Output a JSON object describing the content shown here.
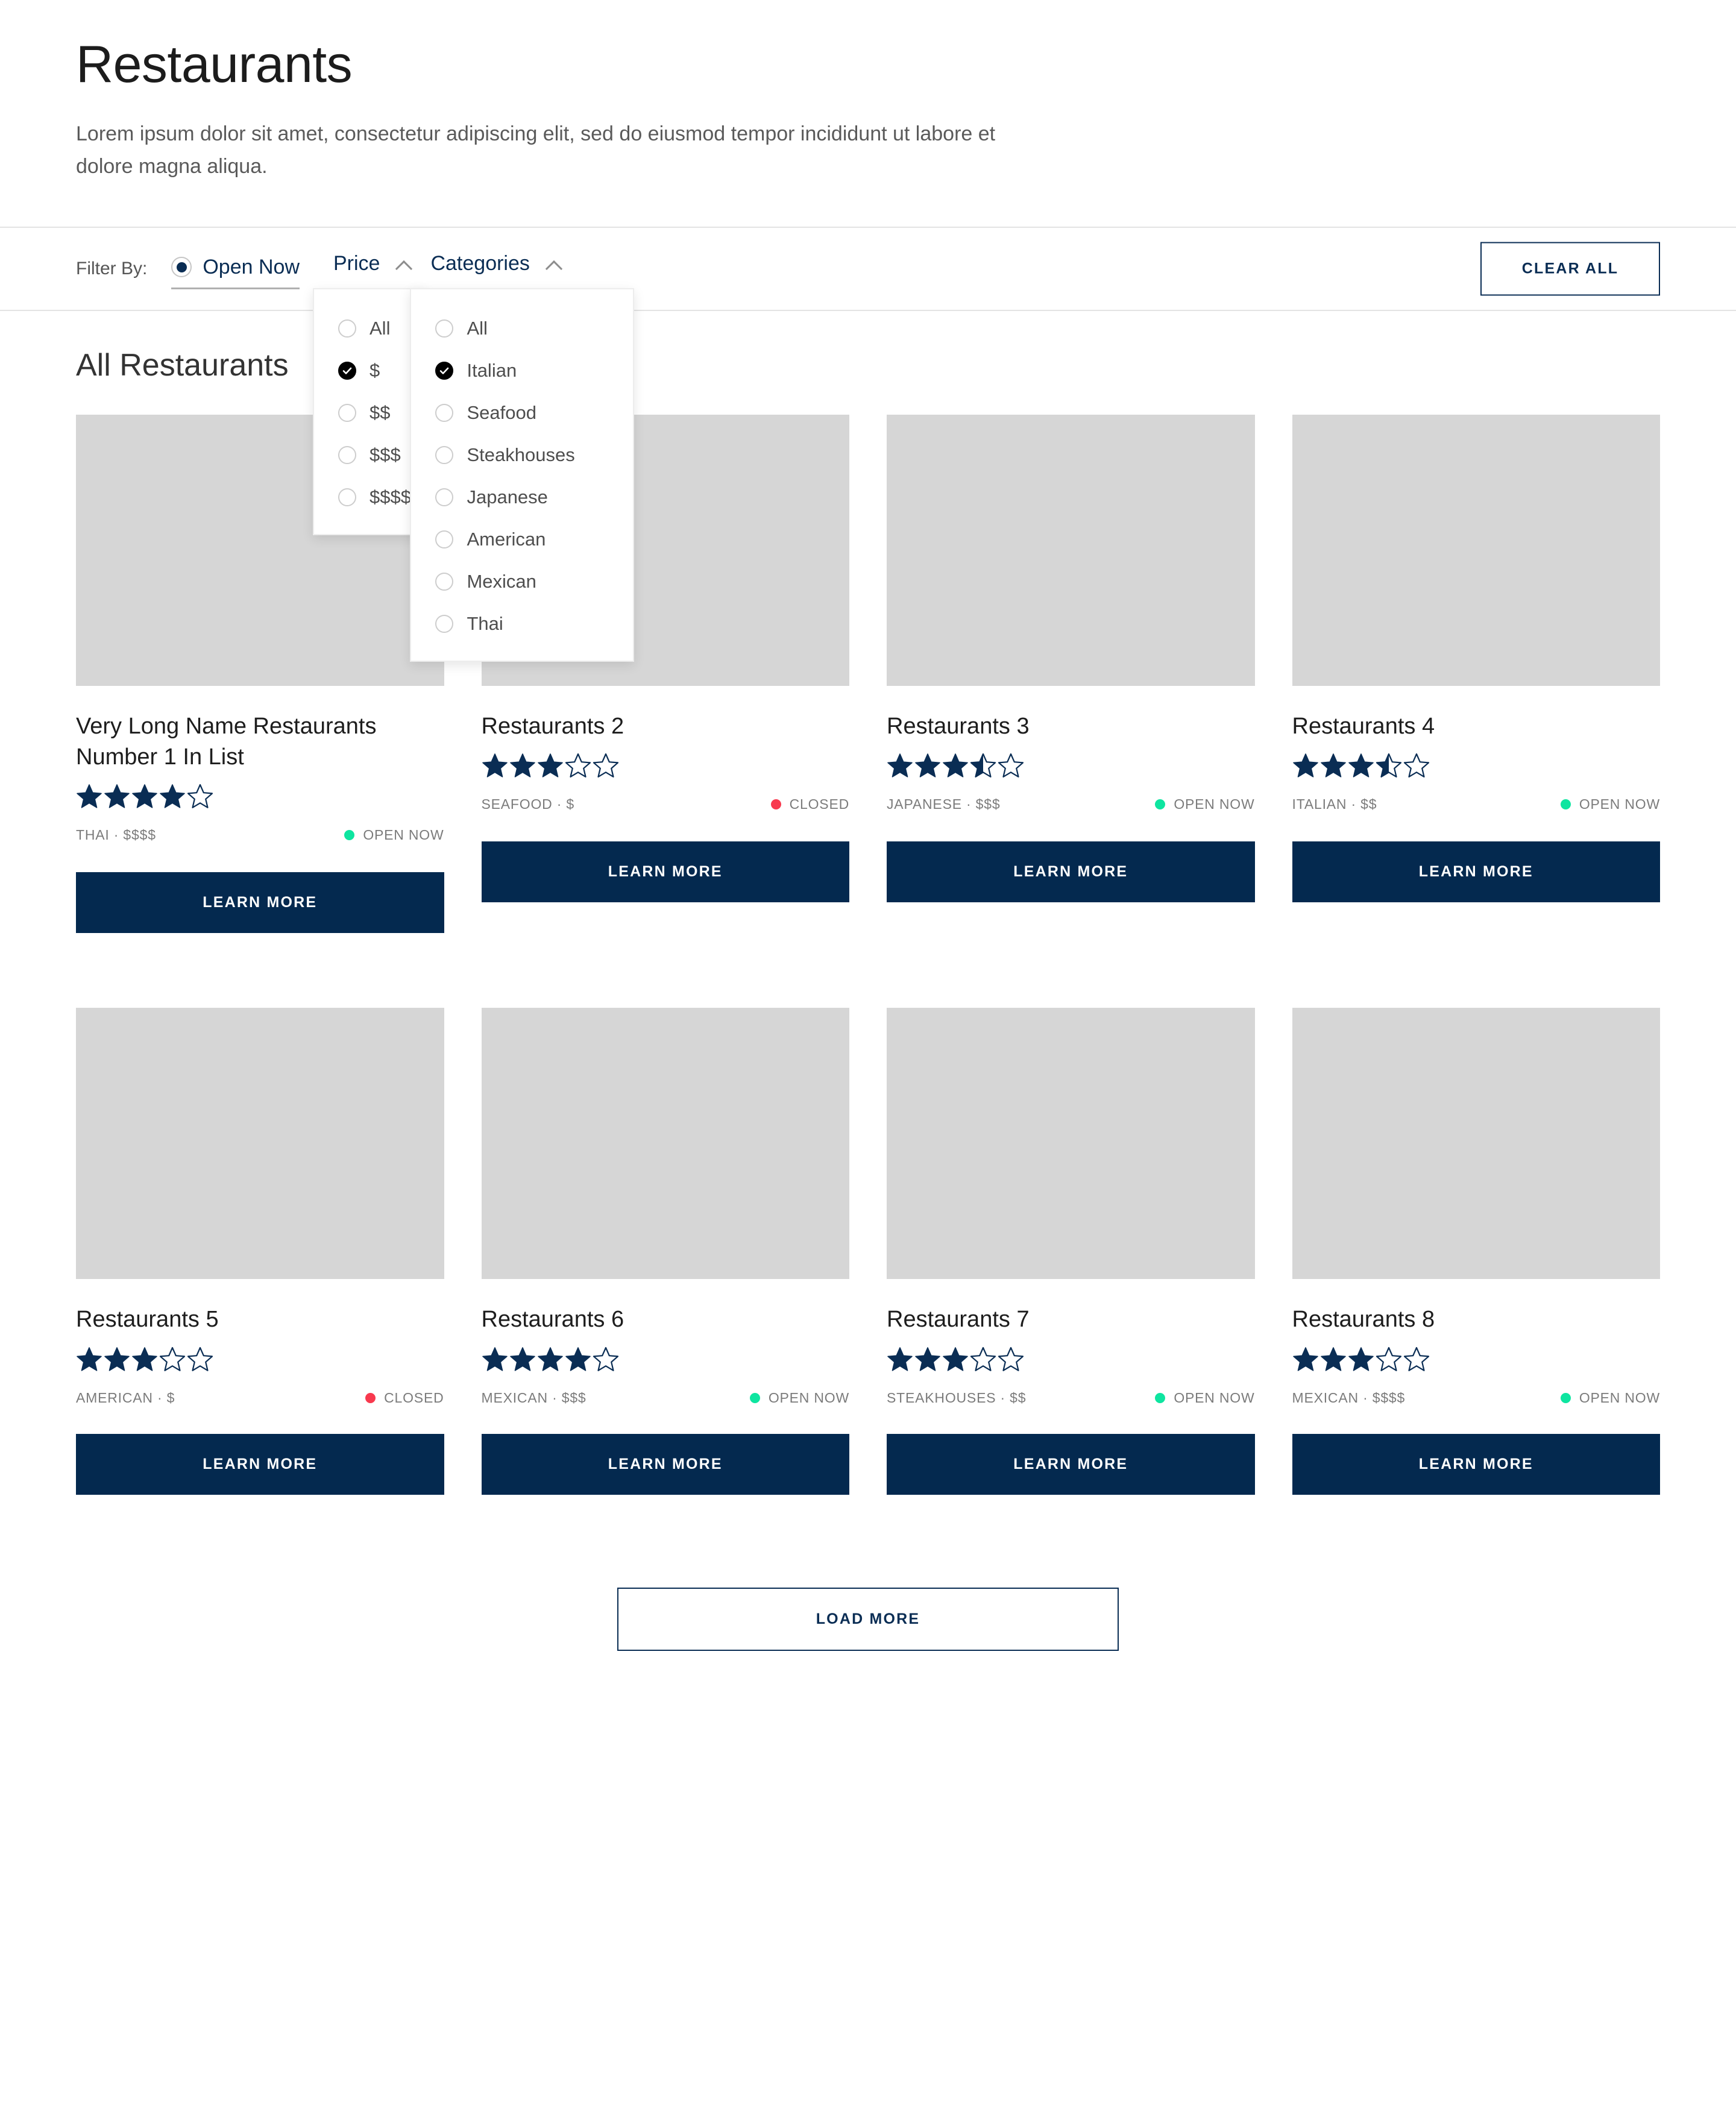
{
  "hero": {
    "title": "Restaurants",
    "subtitle": "Lorem ipsum dolor sit amet, consectetur adipiscing elit, sed do eiusmod tempor incididunt ut labore et dolore magna aliqua."
  },
  "filters": {
    "label": "Filter By:",
    "open_now": {
      "label": "Open Now",
      "selected": true
    },
    "price": {
      "title": "Price",
      "expanded": true,
      "options": [
        {
          "label": "All",
          "checked": false
        },
        {
          "label": "$",
          "checked": true
        },
        {
          "label": "$$",
          "checked": false
        },
        {
          "label": "$$$",
          "checked": false
        },
        {
          "label": "$$$$",
          "checked": false
        }
      ]
    },
    "categories": {
      "title": "Categories",
      "expanded": true,
      "options": [
        {
          "label": "All",
          "checked": false
        },
        {
          "label": "Italian",
          "checked": true
        },
        {
          "label": "Seafood",
          "checked": false
        },
        {
          "label": "Steakhouses",
          "checked": false
        },
        {
          "label": "Japanese",
          "checked": false
        },
        {
          "label": "American",
          "checked": false
        },
        {
          "label": "Mexican",
          "checked": false
        },
        {
          "label": "Thai",
          "checked": false
        }
      ]
    },
    "clear_all_label": "CLEAR ALL"
  },
  "section": {
    "title": "All Restaurants"
  },
  "cards_row1": [
    {
      "name": "Very Long Name Restaurants Number 1 In List",
      "rating": 4,
      "category": "THAI",
      "price": "$$$$",
      "meta": "THAI · $$$$",
      "status": "OPEN NOW",
      "status_type": "open",
      "cta": "LEARN MORE"
    },
    {
      "name": "Restaurants 2",
      "rating": 3,
      "category": "SEAFOOD",
      "price": "$",
      "meta": "SEAFOOD · $",
      "status": "CLOSED",
      "status_type": "closed",
      "cta": "LEARN MORE"
    },
    {
      "name": "Restaurants 3",
      "rating": 3.5,
      "category": "JAPANESE",
      "price": "$$$",
      "meta": "JAPANESE · $$$",
      "status": "OPEN NOW",
      "status_type": "open",
      "cta": "LEARN MORE"
    },
    {
      "name": "Restaurants 4",
      "rating": 3.5,
      "category": "ITALIAN",
      "price": "$$",
      "meta": "ITALIAN · $$",
      "status": "OPEN NOW",
      "status_type": "open",
      "cta": "LEARN MORE"
    }
  ],
  "cards_row2": [
    {
      "name": "Restaurants 5",
      "rating": 3,
      "category": "AMERICAN",
      "price": "$",
      "meta": "AMERICAN · $",
      "status": "CLOSED",
      "status_type": "closed",
      "cta": "LEARN MORE"
    },
    {
      "name": "Restaurants 6",
      "rating": 4,
      "category": "MEXICAN",
      "price": "$$$",
      "meta": "MEXICAN · $$$",
      "status": "OPEN NOW",
      "status_type": "open",
      "cta": "LEARN MORE"
    },
    {
      "name": "Restaurants 7",
      "rating": 3,
      "category": "STEAKHOUSES",
      "price": "$$",
      "meta": "STEAKHOUSES · $$",
      "status": "OPEN NOW",
      "status_type": "open",
      "cta": "LEARN MORE"
    },
    {
      "name": "Restaurants 8",
      "rating": 3,
      "category": "MEXICAN",
      "price": "$$$$",
      "meta": "MEXICAN · $$$$",
      "status": "OPEN NOW",
      "status_type": "open",
      "cta": "LEARN MORE"
    }
  ],
  "load_more": {
    "label": "LOAD MORE"
  },
  "colors": {
    "navy": "#04294f",
    "navy_text": "#0a2d54",
    "open_green": "#0ee5a0",
    "closed_red": "#f8394e",
    "placeholder_gray": "#d6d6d6"
  }
}
